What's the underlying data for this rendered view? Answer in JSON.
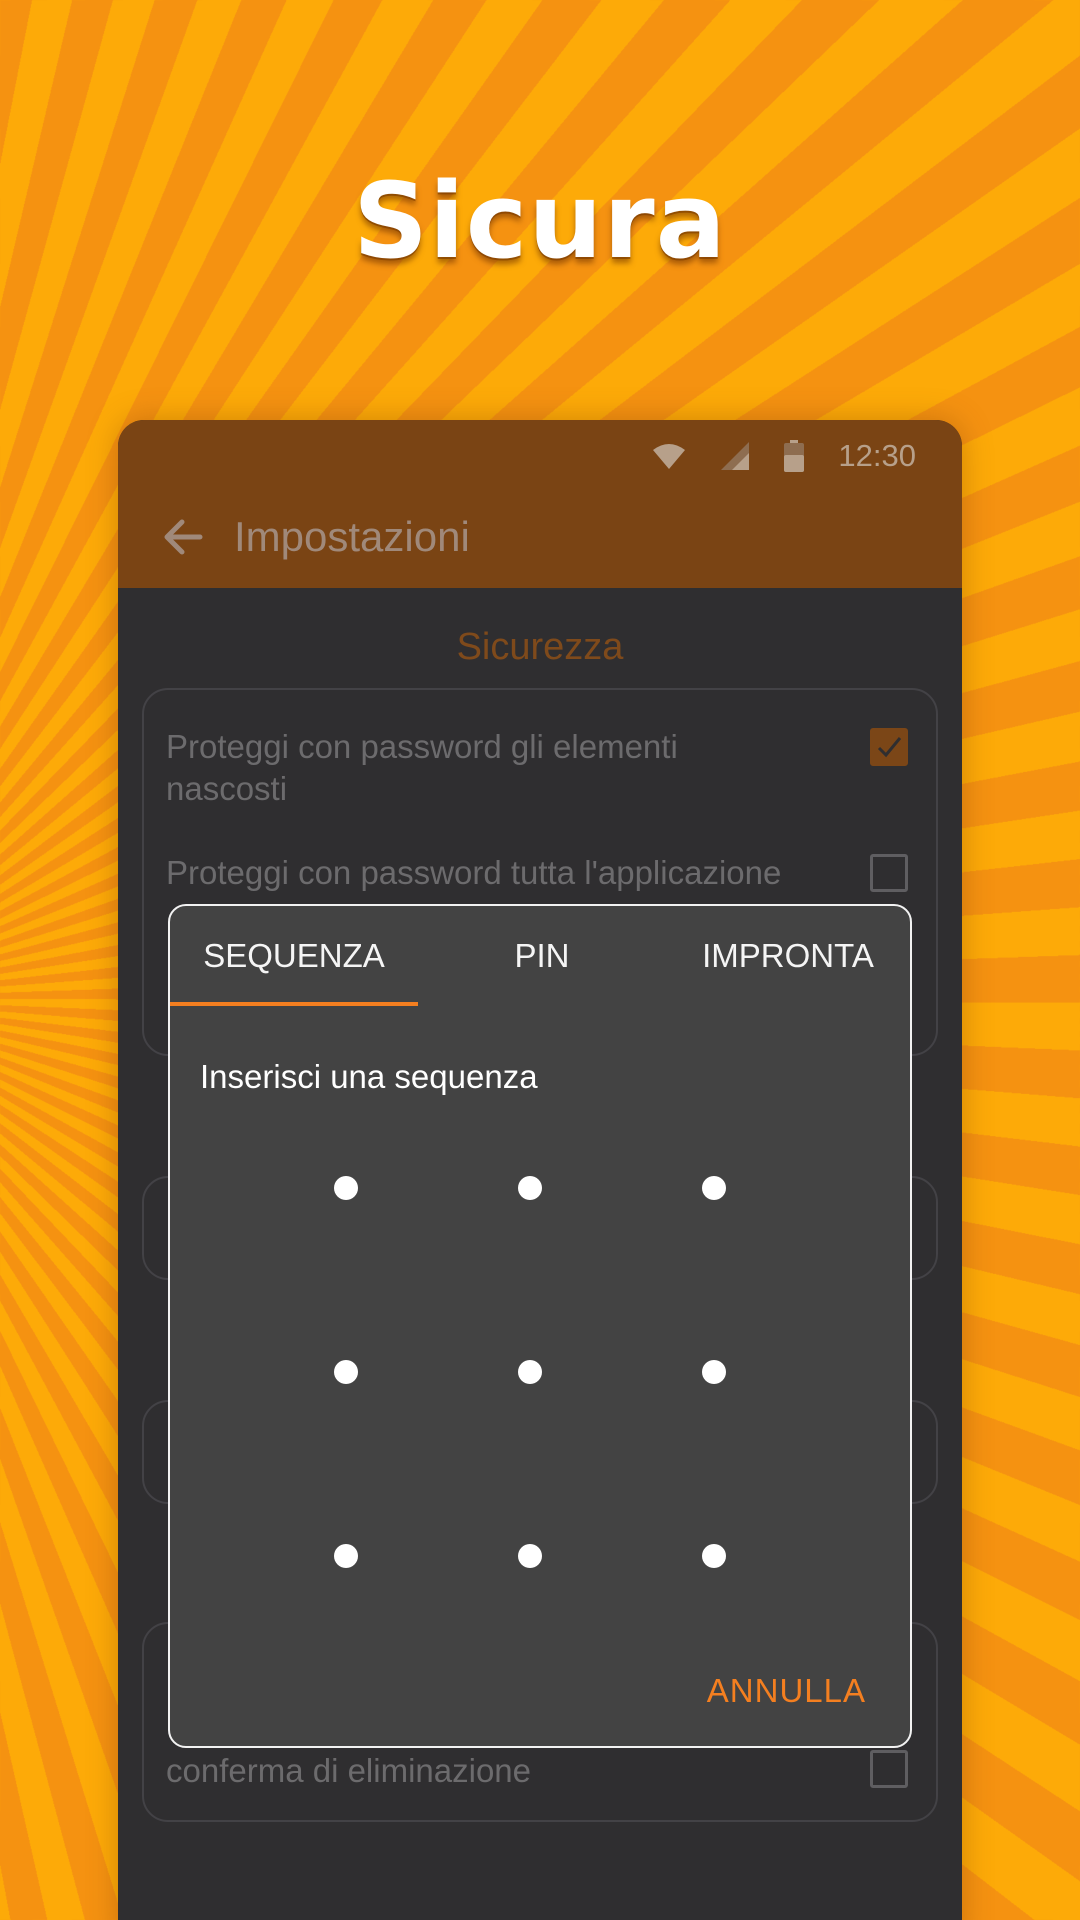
{
  "headline": "Sicura",
  "status_bar": {
    "time": "12:30",
    "icons": [
      "wifi-icon",
      "signal-icon",
      "battery-icon"
    ]
  },
  "toolbar": {
    "title": "Impostazioni",
    "back_icon": "arrow-back-icon"
  },
  "section": {
    "title": "Sicurezza"
  },
  "settings": {
    "protect_hidden": {
      "label": "Proteggi con password gli elementi nascosti",
      "checked": true
    },
    "protect_app": {
      "label": "Proteggi con password tutta l'applicazione",
      "checked": false
    },
    "delete_confirm": {
      "label": "conferma di eliminazione",
      "checked": false
    }
  },
  "dialog": {
    "tabs": [
      {
        "label": "SEQUENZA",
        "selected": true
      },
      {
        "label": "PIN",
        "selected": false
      },
      {
        "label": "IMPRONTA",
        "selected": false
      }
    ],
    "prompt": "Inserisci una sequenza",
    "pattern_grid": {
      "rows": 3,
      "cols": 3
    },
    "cancel_label": "ANNULLA"
  },
  "colors": {
    "accent": "#f47f20",
    "app_bar": "#7a4414",
    "background_stripe_dark": "#f59211",
    "background_stripe_light": "#fdaa08",
    "dialog_bg": "#434343"
  }
}
